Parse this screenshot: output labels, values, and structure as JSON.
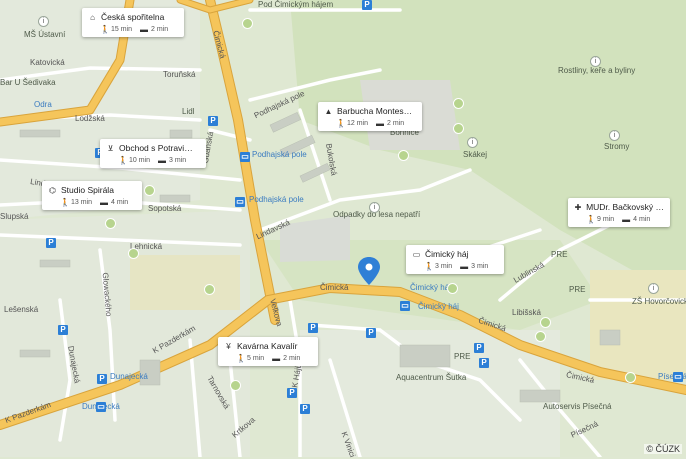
{
  "selected_place": "Čimický háj",
  "streets": {
    "cimicka_1": "Čimická",
    "cimicka_2": "Čimická",
    "cimicka_3": "Čimická",
    "k_pazderkam_1": "K Pazderkám",
    "k_pazderkam_2": "K Pazderkám",
    "gdanska": "Gdaňská",
    "cimicka_v": "Čimická",
    "podhajska_pole": "Podhajská pole",
    "bukolska": "Bukolská",
    "lindavska": "Lindavská",
    "sopotska": "Sopotská",
    "lehnicka": "Lehnická",
    "katovicka": "Katovická",
    "torunska": "Toruňská",
    "lodzska": "Lodžská",
    "odpadky": "Odpadky do lesa nepatří",
    "lublinska": "Lublinská",
    "libisska": "Libišská",
    "luhovska": "Luhovská",
    "glowackeho": "Glowackého",
    "dunajecka": "Dunajecká",
    "tarnovska": "Tarnovská",
    "velkova": "Velkova",
    "k_hajum": "K Hájům",
    "k_vinici": "K Vinici",
    "pisecna": "Písečná",
    "pisecna_stop": "Písečná",
    "lesnenska": "Lešenská",
    "lindavska2": "Lindavská",
    "slupska": "Slupská",
    "krtkova": "Krtkova"
  },
  "places": {
    "ms_ustavni": "MŠ Ústavní",
    "podhajska_pole_stop": "Podhajská pole",
    "podhajska_pole_stop2": "Podhajská pole",
    "bohnice": "Bohnice",
    "cimicky_haj_stop": "Čimický háj",
    "cimicky_haj_stop2": "Čimický háj",
    "skakej": "Skákej",
    "stromy": "Stromy",
    "rostliny": "Rostliny, keře a byliny",
    "aquacentrum": "Aquacentrum Šutka",
    "autoservis": "Autoservis Písečná",
    "zs_hovorcovice": "ZŠ Hovorčovická",
    "dunajecka_stop": "Dunajecká",
    "dunajecka_stop2": "Dunajecká",
    "lidl": "Lidl",
    "odra": "Odra",
    "bar_u_sedivaka": "Bar U Šedivaka",
    "cimickym_hajem": "Pod Čimickým hájem",
    "pre_1": "PRE",
    "pre_2": "PRE",
    "pre_3": "PRE"
  },
  "cards": [
    {
      "name": "Česká spořitelna",
      "icon": "bank-icon",
      "walk": "15 min",
      "drive": "2 min"
    },
    {
      "name": "Obchod s Potravi…",
      "icon": "cart-icon",
      "walk": "10 min",
      "drive": "3 min"
    },
    {
      "name": "Studio Spirála",
      "icon": "studio-icon",
      "walk": "13 min",
      "drive": "4 min"
    },
    {
      "name": "Barbucha Montes…",
      "icon": "school-icon",
      "walk": "12 min",
      "drive": "2 min"
    },
    {
      "name": "Čimický háj",
      "icon": "bus-icon",
      "walk": "3 min",
      "drive": "3 min"
    },
    {
      "name": "MUDr. Bačkovský …",
      "icon": "clinic-icon",
      "walk": "9 min",
      "drive": "4 min"
    },
    {
      "name": "Kavárna Kavalír",
      "icon": "cafe-icon",
      "walk": "5 min",
      "drive": "2 min"
    }
  ],
  "icons": {
    "walk": "walk-icon",
    "car": "car-icon",
    "pin": "location-pin-icon"
  },
  "colors": {
    "main_road": "#f5c55b",
    "road_outline": "#d9a43c",
    "park": "#c9dbb0",
    "pin": "#2f7fd6"
  },
  "copyright": "© ČÚZK"
}
